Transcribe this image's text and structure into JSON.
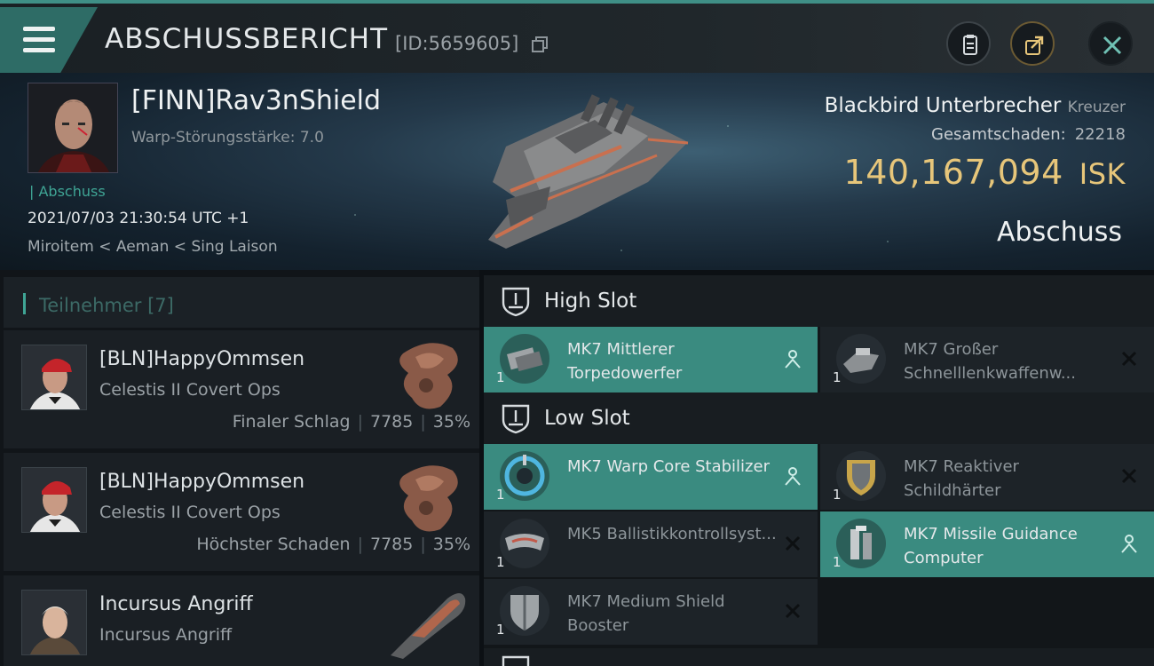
{
  "header": {
    "title": "ABSCHUSSBERICHT",
    "report_id": "[ID:5659605]"
  },
  "victim": {
    "name": "[FINN]Rav3nShield",
    "warp_strength": "Warp-Störungsstärke: 7.0",
    "tag": "| Abschuss",
    "time": "2021/07/03 21:30:54 UTC +1",
    "location": "Miroitem < Aeman < Sing Laison"
  },
  "ship": {
    "name": "Blackbird Unterbrecher",
    "class": "Kreuzer",
    "damage_label": "Gesamtschaden:",
    "damage_value": "22218",
    "isk_value": "140,167,094",
    "isk_unit": "ISK",
    "result": "Abschuss"
  },
  "participants": {
    "title": "Teilnehmer [7]",
    "rows": [
      {
        "name": "[BLN]HappyOmmsen",
        "ship": "Celestis II Covert Ops",
        "role": "Finaler Schlag",
        "damage": "7785",
        "percent": "35%"
      },
      {
        "name": "[BLN]HappyOmmsen",
        "ship": "Celestis II Covert Ops",
        "role": "Höchster Schaden",
        "damage": "7785",
        "percent": "35%"
      },
      {
        "name": "Incursus Angriff",
        "ship": "Incursus Angriff",
        "role": "",
        "damage": "",
        "percent": ""
      }
    ]
  },
  "fittings": {
    "high_slot_title": "High Slot",
    "low_slot_title": "Low Slot",
    "high": [
      {
        "name": "MK7 Mittlerer Torpedowerfer",
        "qty": "1",
        "state": "dropped"
      },
      {
        "name": "MK7 Großer Schnelllenkwaffenw...",
        "qty": "1",
        "state": "destroyed"
      }
    ],
    "low": [
      {
        "name": "MK7 Warp Core Stabilizer",
        "qty": "1",
        "state": "dropped"
      },
      {
        "name": "MK7 Reaktiver Schildhärter",
        "qty": "1",
        "state": "destroyed"
      },
      {
        "name": "MK5 Ballistikkontrollsyst...",
        "qty": "1",
        "state": "destroyed"
      },
      {
        "name": "MK7 Missile Guidance Computer",
        "qty": "1",
        "state": "dropped"
      },
      {
        "name": "MK7 Medium Shield Booster",
        "qty": "1",
        "state": "destroyed"
      }
    ]
  },
  "colors": {
    "accent_teal": "#3a8b80",
    "isk_gold": "#e7c67a"
  }
}
